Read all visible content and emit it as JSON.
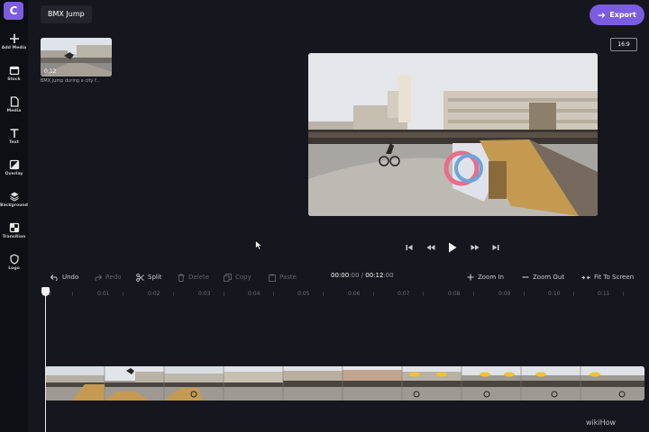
{
  "project": {
    "title": "BMX Jump"
  },
  "header": {
    "export_label": "Export",
    "aspect_ratio": "16:9"
  },
  "sidebar": {
    "items": [
      {
        "label": "Add Media",
        "icon": "plus-icon"
      },
      {
        "label": "Stock",
        "icon": "stock-icon"
      },
      {
        "label": "Media",
        "icon": "media-file-icon"
      },
      {
        "label": "Text",
        "icon": "text-icon"
      },
      {
        "label": "Overlay",
        "icon": "overlay-icon"
      },
      {
        "label": "Background",
        "icon": "layers-icon"
      },
      {
        "label": "Transition",
        "icon": "transition-icon"
      },
      {
        "label": "Logo",
        "icon": "shield-icon"
      }
    ]
  },
  "media": {
    "duration": "0:12",
    "name": "BMX jump during a city f..."
  },
  "toolbar": {
    "undo": "Undo",
    "redo": "Redo",
    "split": "Split",
    "delete": "Delete",
    "copy": "Copy",
    "paste": "Paste",
    "zoom_in": "Zoom In",
    "zoom_out": "Zoom Out",
    "fit": "Fit To Screen"
  },
  "timecode": {
    "current_main": "00:00",
    "current_sub": ":00",
    "separator": " / ",
    "total_main": "00:12",
    "total_sub": ":00"
  },
  "ruler": {
    "ticks": [
      "0:01",
      "0:02",
      "0:03",
      "0:04",
      "0:05",
      "0:06",
      "0:07",
      "0:08",
      "0:09",
      "0:10",
      "0:11"
    ],
    "start": "0"
  },
  "watermark": "wikiHow",
  "colors": {
    "accent": "#7c5ce0",
    "background": "#16171e",
    "sidebar": "#0e0f14"
  }
}
